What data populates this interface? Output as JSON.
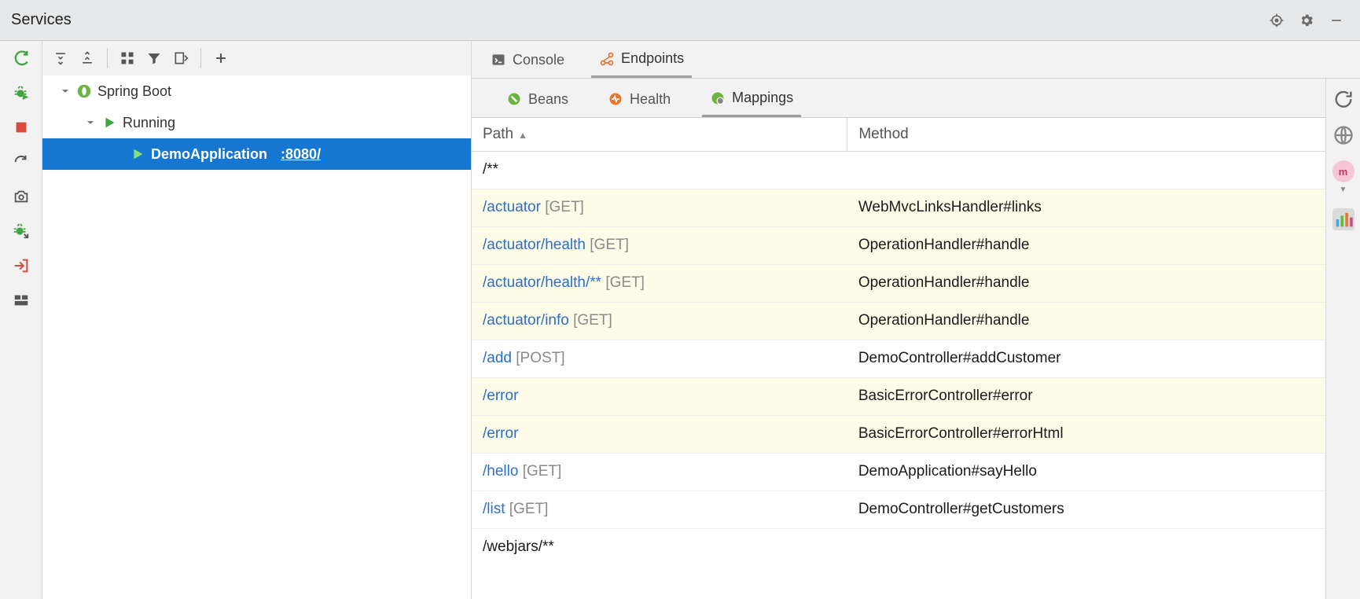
{
  "panel": {
    "title": "Services"
  },
  "tree": {
    "root": "Spring Boot",
    "running_label": "Running",
    "app_name": "DemoApplication",
    "app_port": ":8080/"
  },
  "tabs": {
    "console": "Console",
    "endpoints": "Endpoints"
  },
  "subtabs": {
    "beans": "Beans",
    "health": "Health",
    "mappings": "Mappings"
  },
  "columns": {
    "path": "Path",
    "method": "Method"
  },
  "rows": [
    {
      "path": "/**",
      "verb": "",
      "method": "",
      "hl": false
    },
    {
      "path": "/actuator",
      "verb": "[GET]",
      "method": "WebMvcLinksHandler#links",
      "hl": true
    },
    {
      "path": "/actuator/health",
      "verb": "[GET]",
      "method": "OperationHandler#handle",
      "hl": true
    },
    {
      "path": "/actuator/health/**",
      "verb": "[GET]",
      "method": "OperationHandler#handle",
      "hl": true
    },
    {
      "path": "/actuator/info",
      "verb": "[GET]",
      "method": "OperationHandler#handle",
      "hl": true
    },
    {
      "path": "/add",
      "verb": "[POST]",
      "method": "DemoController#addCustomer",
      "hl": false
    },
    {
      "path": "/error",
      "verb": "",
      "method": "BasicErrorController#error",
      "hl": true
    },
    {
      "path": "/error",
      "verb": "",
      "method": "BasicErrorController#errorHtml",
      "hl": true
    },
    {
      "path": "/hello",
      "verb": "[GET]",
      "method": "DemoApplication#sayHello",
      "hl": false
    },
    {
      "path": "/list",
      "verb": "[GET]",
      "method": "DemoController#getCustomers",
      "hl": false
    },
    {
      "path": "/webjars/**",
      "verb": "",
      "method": "",
      "hl": false
    }
  ],
  "rightBadge": "m"
}
